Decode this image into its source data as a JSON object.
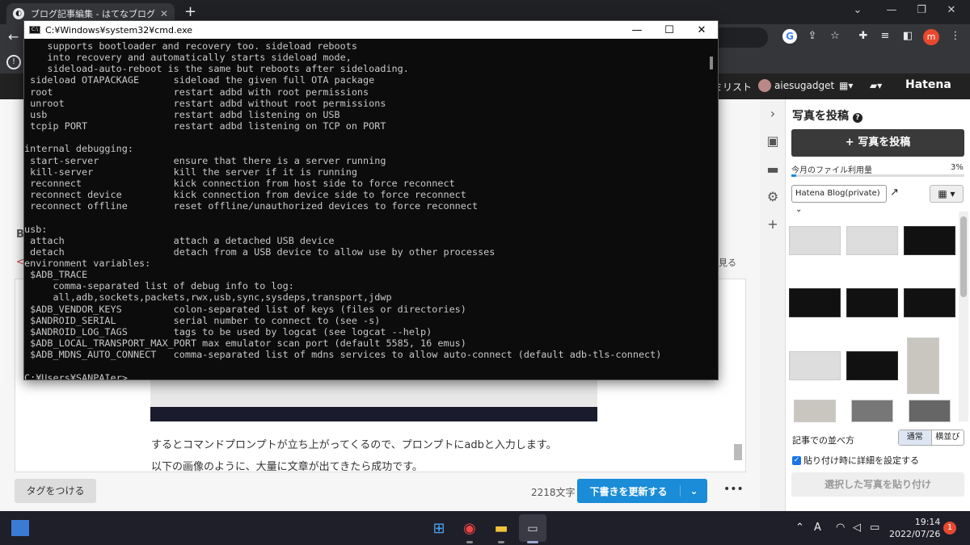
{
  "browser": {
    "tab_title": "ブログ記事編集 - はてなブログ",
    "tab_icon": "hatena-blog-icon",
    "window_controls": [
      "⌄",
      "—",
      "❐",
      "✕"
    ]
  },
  "hatena_header": {
    "list_link": "ミリスト",
    "user": "aiesugadget",
    "logo": "Hatena"
  },
  "cmd": {
    "title": "C:¥Windows¥system32¥cmd.exe",
    "lines": [
      "    supports bootloader and recovery too. sideload reboots",
      "    into recovery and automatically starts sideload mode,",
      "    sideload-auto-reboot is the same but reboots after sideloading.",
      " sideload OTAPACKAGE      sideload the given full OTA package",
      " root                     restart adbd with root permissions",
      " unroot                   restart adbd without root permissions",
      " usb                      restart adbd listening on USB",
      " tcpip PORT               restart adbd listening on TCP on PORT",
      "",
      "internal debugging:",
      " start-server             ensure that there is a server running",
      " kill-server              kill the server if it is running",
      " reconnect                kick connection from host side to force reconnect",
      " reconnect device         kick connection from device side to force reconnect",
      " reconnect offline        reset offline/unauthorized devices to force reconnect",
      "",
      "usb:",
      " attach                   attach a detached USB device",
      " detach                   detach from a USB device to allow use by other processes",
      "environment variables:",
      " $ADB_TRACE",
      "     comma-separated list of debug info to log:",
      "     all,adb,sockets,packets,rwx,usb,sync,sysdeps,transport,jdwp",
      " $ADB_VENDOR_KEYS         colon-separated list of keys (files or directories)",
      " $ANDROID_SERIAL          serial number to connect to (see -s)",
      " $ANDROID_LOG_TAGS        tags to be used by logcat (see logcat --help)",
      " $ADB_LOCAL_TRANSPORT_MAX_PORT max emulator scan port (default 5585, 16 emus)",
      " $ADB_MDNS_AUTO_CONNECT   comma-separated list of mdns services to allow auto-connect (default adb-tls-connect)",
      "",
      "C:¥Users¥SANPAIer>"
    ]
  },
  "editor": {
    "paragraph1": "するとコマンドプロンプトが立ち上がってくるので、プロンプトにadbと入力します。",
    "paragraph2": "以下の画像のように、大量に文章が出てきたら成功です。",
    "see_more": "と見る",
    "left_markers": [
      "B",
      "<"
    ]
  },
  "bottom_bar": {
    "tag_button": "タグをつける",
    "char_count": "2218文字",
    "update_button": "下書きを更新する",
    "more": "•••"
  },
  "photo_panel": {
    "title": "写真を投稿",
    "help": "?",
    "upload_button": "+ 写真を投稿",
    "usage_label": "今月のファイル利用量",
    "usage_percent": "3%",
    "usage_fraction": 0.03,
    "album": "Hatena Blog(private)",
    "sort_label": "記事での並べ方",
    "sort_options": [
      "通常",
      "横並び"
    ],
    "sort_selected": "通常",
    "checkbox_label": "貼り付け時に詳細を設定する",
    "checkbox_checked": true,
    "paste_button": "選択した写真を貼り付け"
  },
  "taskbar": {
    "time": "19:14",
    "date": "2022/07/26",
    "notifications": "1",
    "ime": "A"
  }
}
